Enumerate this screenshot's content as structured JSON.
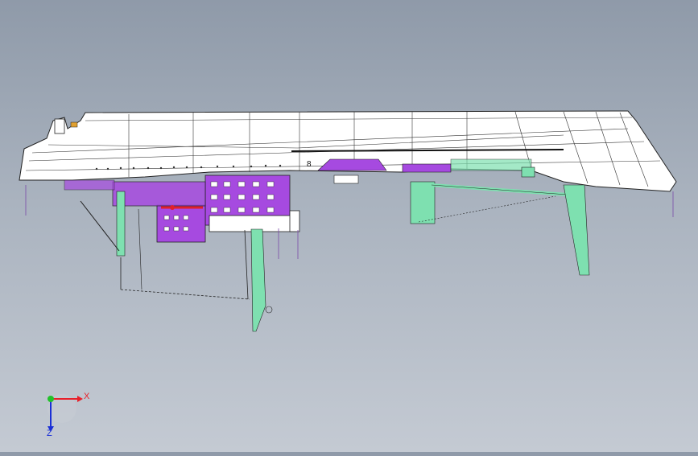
{
  "viewport": {
    "background_top": "#8f9aa9",
    "background_bottom": "#c4cad3",
    "model_colors": {
      "shell": "#ffffff",
      "outline": "#222222",
      "purple": "#a64ae0",
      "green": "#7ee0b0",
      "red": "#e0202a"
    }
  },
  "model": {
    "marker_label": "8"
  },
  "triad": {
    "x_label": "X",
    "z_label": "Z",
    "x_color": "#e8202a",
    "y_color": "#22c22a",
    "z_color": "#1a2fd6"
  }
}
